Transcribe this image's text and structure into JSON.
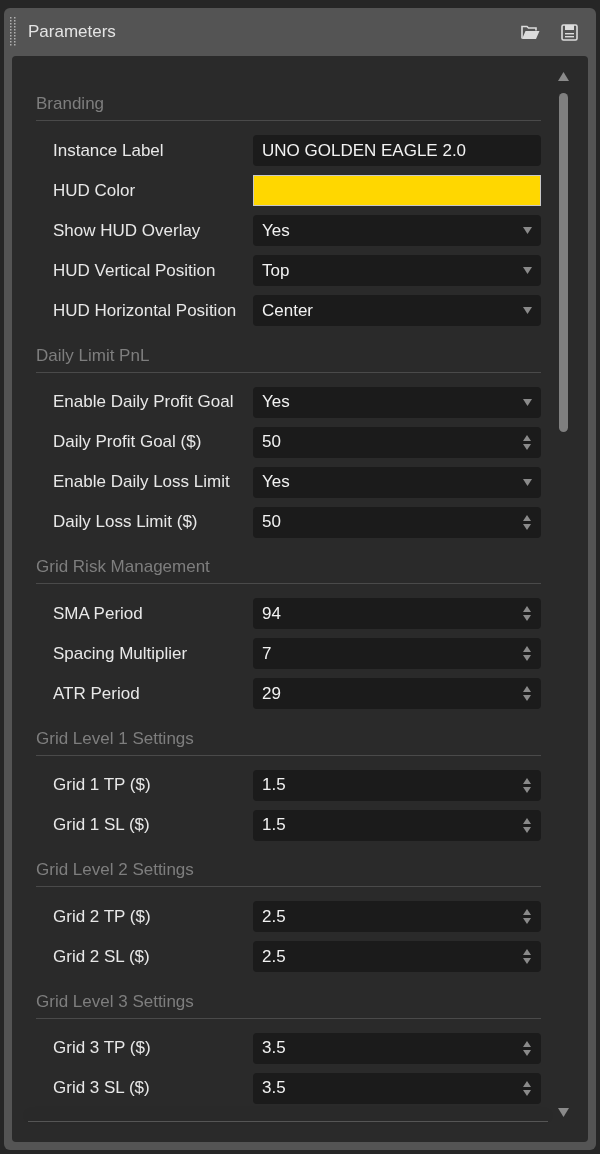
{
  "window": {
    "title": "Parameters"
  },
  "sections": [
    {
      "title": "Branding",
      "rows": [
        {
          "label": "Instance Label",
          "kind": "text",
          "value": "UNO GOLDEN EAGLE 2.0"
        },
        {
          "label": "HUD Color",
          "kind": "color",
          "color": "#ffd700"
        },
        {
          "label": "Show HUD Overlay",
          "kind": "select",
          "value": "Yes"
        },
        {
          "label": "HUD Vertical Position",
          "kind": "select",
          "value": "Top"
        },
        {
          "label": "HUD Horizontal Position",
          "kind": "select",
          "value": "Center"
        }
      ]
    },
    {
      "title": "Daily Limit PnL",
      "rows": [
        {
          "label": "Enable Daily Profit Goal",
          "kind": "select",
          "value": "Yes"
        },
        {
          "label": "Daily Profit Goal ($)",
          "kind": "number",
          "value": "50"
        },
        {
          "label": "Enable Daily Loss Limit",
          "kind": "select",
          "value": "Yes"
        },
        {
          "label": "Daily Loss Limit ($)",
          "kind": "number",
          "value": "50"
        }
      ]
    },
    {
      "title": "Grid Risk Management",
      "rows": [
        {
          "label": "SMA Period",
          "kind": "number",
          "value": "94"
        },
        {
          "label": "Spacing Multiplier",
          "kind": "number",
          "value": "7"
        },
        {
          "label": "ATR Period",
          "kind": "number",
          "value": "29"
        }
      ]
    },
    {
      "title": "Grid Level 1 Settings",
      "rows": [
        {
          "label": "Grid 1 TP ($)",
          "kind": "number",
          "value": "1.5"
        },
        {
          "label": "Grid 1 SL ($)",
          "kind": "number",
          "value": "1.5"
        }
      ]
    },
    {
      "title": "Grid Level 2 Settings",
      "rows": [
        {
          "label": "Grid 2 TP ($)",
          "kind": "number",
          "value": "2.5"
        },
        {
          "label": "Grid 2 SL ($)",
          "kind": "number",
          "value": "2.5"
        }
      ]
    },
    {
      "title": "Grid Level 3 Settings",
      "rows": [
        {
          "label": "Grid 3 TP ($)",
          "kind": "number",
          "value": "3.5"
        },
        {
          "label": "Grid 3 SL ($)",
          "kind": "number",
          "value": "3.5"
        }
      ]
    }
  ]
}
